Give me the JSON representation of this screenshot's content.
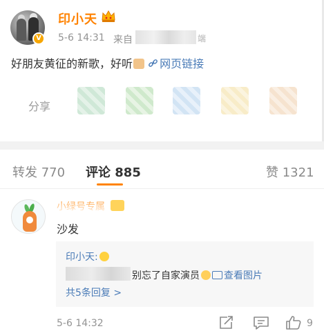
{
  "post": {
    "author_name": "印小天",
    "time": "5-6 14:31",
    "source_prefix": "来自",
    "source_suffix": "端",
    "text": "好朋友黄征的新歌，好听",
    "link_label": "网页链接",
    "share_label": "分享"
  },
  "tabs": {
    "repost": "转发 770",
    "comments": "评论 885",
    "likes": "赞 1321"
  },
  "comment": {
    "author_name": "小绿号专属",
    "text": "沙发",
    "time": "5-6 14:32",
    "like_count": "9",
    "reply": {
      "author": "印小天:",
      "text": "别忘了自家演员",
      "image_link": "查看图片",
      "more": "共5条回复 >"
    }
  },
  "icons": {
    "vip": "v-badge-icon",
    "crown": "crown-icon",
    "link": "link-icon",
    "share": "share-icon",
    "comment": "comment-icon",
    "like": "thumbs-up-icon"
  },
  "colors": {
    "accent": "#ff8200",
    "link": "#4a7bb7",
    "muted": "#939393"
  }
}
